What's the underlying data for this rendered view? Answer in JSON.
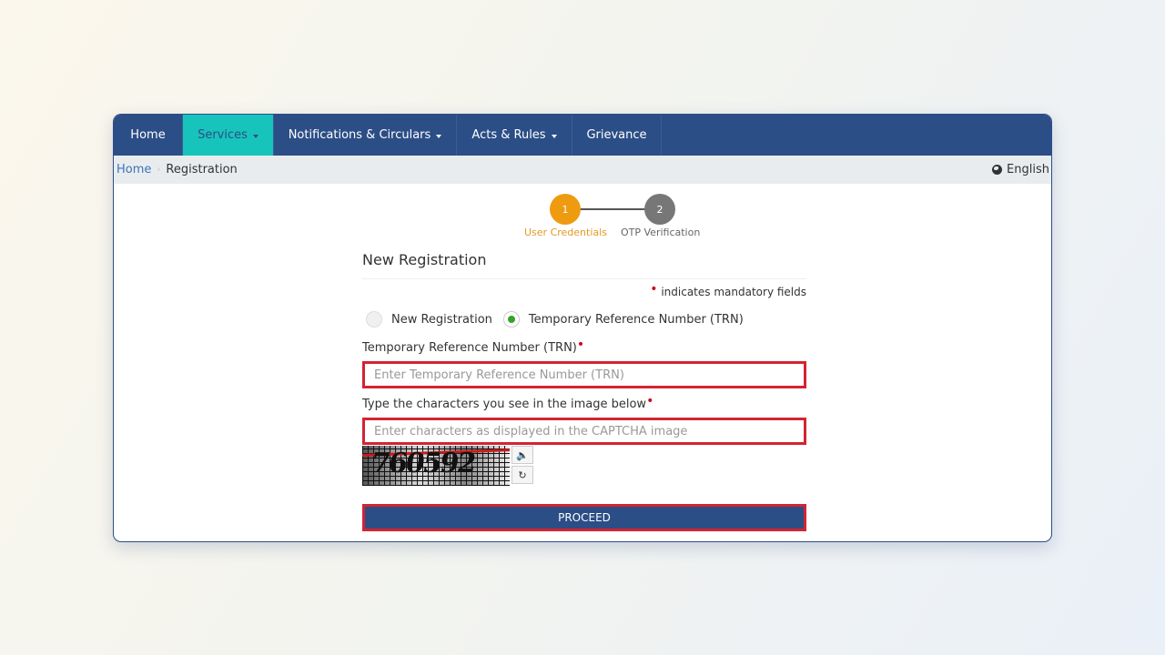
{
  "navbar": {
    "items": [
      {
        "label": "Home",
        "has_caret": false,
        "active": false
      },
      {
        "label": "Services",
        "has_caret": true,
        "active": true
      },
      {
        "label": "Notifications & Circulars",
        "has_caret": true,
        "active": false
      },
      {
        "label": "Acts & Rules",
        "has_caret": true,
        "active": false
      },
      {
        "label": "Grievance",
        "has_caret": false,
        "active": false
      }
    ]
  },
  "breadcrumb": {
    "home": "Home",
    "current": "Registration",
    "separator": "›"
  },
  "language": {
    "icon": "globe-icon",
    "label": "English"
  },
  "stepper": {
    "steps": [
      {
        "number": "1",
        "label": "User Credentials",
        "state": "active",
        "color": "#ee9b10"
      },
      {
        "number": "2",
        "label": "OTP Verification",
        "state": "pending",
        "color": "#777777"
      }
    ]
  },
  "form": {
    "title": "New Registration",
    "mandatory_note": "indicates mandatory fields",
    "mandatory_marker": "•",
    "radios": [
      {
        "label": "New Registration",
        "checked": false
      },
      {
        "label": "Temporary Reference Number (TRN)",
        "checked": true
      }
    ],
    "trn": {
      "label": "Temporary Reference Number (TRN)",
      "value": "",
      "placeholder": "Enter Temporary Reference Number (TRN)"
    },
    "captcha": {
      "label": "Type the characters you see in the image below",
      "value": "",
      "placeholder": "Enter characters as displayed in the CAPTCHA image",
      "image_text": "760592",
      "audio_icon": "speaker-icon",
      "refresh_icon": "refresh-icon"
    },
    "proceed_label": "PROCEED"
  },
  "colors": {
    "nav_bg": "#2c4e86",
    "nav_active": "#17c4bb",
    "error_border": "#d32432",
    "radio_checked": "#35a32a"
  }
}
